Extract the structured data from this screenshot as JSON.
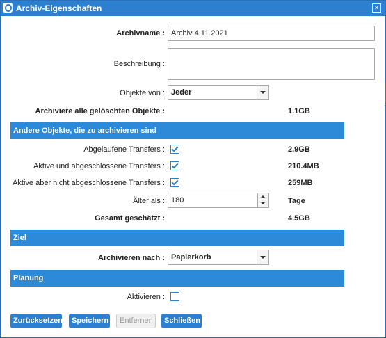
{
  "window": {
    "title": "Archiv-Eigenschaften",
    "close_label": "×"
  },
  "form": {
    "archivname_label": "Archivname :",
    "archivname_value": "Archiv 4.11.2021",
    "beschreibung_label": "Beschreibung :",
    "beschreibung_value": "",
    "objekte_label": "Objekte von :",
    "objekte_value": "Jeder",
    "geloeschte_label": "Archiviere alle gelöschten Objekte :",
    "geloeschte_value": "1.1GB"
  },
  "section_andere": {
    "title": "Andere Objekte, die zu archivieren sind",
    "rows": [
      {
        "label": "Abgelaufene Transfers :",
        "checked": true,
        "size": "2.9GB"
      },
      {
        "label": "Aktive und abgeschlossene Transfers :",
        "checked": true,
        "size": "210.4MB"
      },
      {
        "label": "Aktive aber nicht abgeschlossene Transfers :",
        "checked": true,
        "size": "259MB"
      }
    ],
    "aelter_label": "Älter als :",
    "aelter_value": "180",
    "aelter_unit": "Tage",
    "gesamt_label": "Gesamt geschätzt :",
    "gesamt_value": "4.5GB"
  },
  "section_ziel": {
    "title": "Ziel",
    "archivieren_label": "Archivieren nach :",
    "archivieren_value": "Papierkorb"
  },
  "section_planung": {
    "title": "Planung",
    "aktivieren_label": "Aktivieren :",
    "aktivieren_checked": false
  },
  "buttons": {
    "reset": "Zurücksetzen",
    "save": "Speichern",
    "remove": "Entfernen",
    "close": "Schließen"
  }
}
